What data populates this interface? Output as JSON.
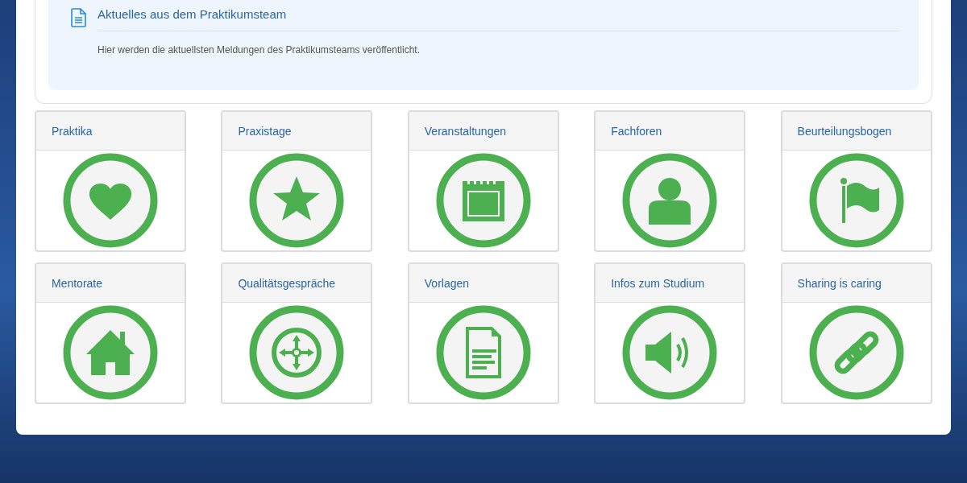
{
  "news": {
    "title": "Aktuelles aus dem Praktikumsteam",
    "text": "Hier werden die aktuellsten Meldungen des Praktikumsteams veröffentlicht."
  },
  "tiles": [
    {
      "label": "Praktika"
    },
    {
      "label": "Praxistage"
    },
    {
      "label": "Veranstaltungen"
    },
    {
      "label": "Fachforen"
    },
    {
      "label": "Beurteilungsbogen"
    },
    {
      "label": "Mentorate"
    },
    {
      "label": "Qualitätsgespräche"
    },
    {
      "label": "Vorlagen"
    },
    {
      "label": "Infos zum Studium"
    },
    {
      "label": "Sharing is caring"
    }
  ]
}
